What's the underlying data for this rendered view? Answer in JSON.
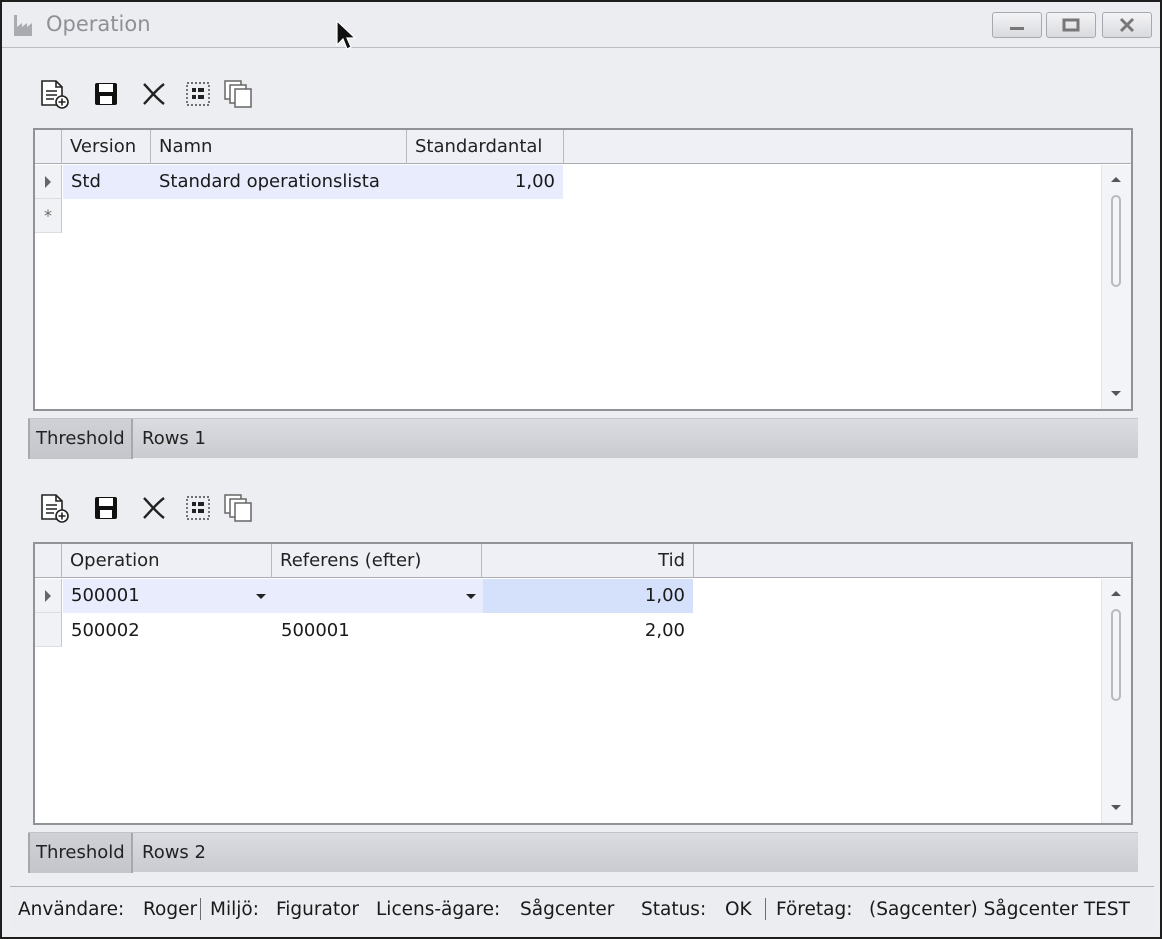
{
  "window": {
    "title": "Operation",
    "icon": "factory-icon",
    "controls": [
      "minimize-icon",
      "maximize-icon",
      "close-icon"
    ]
  },
  "toolbar_icons": [
    "new-document-icon",
    "save-icon",
    "delete-icon",
    "select-icon",
    "copy-icon"
  ],
  "grid1": {
    "columns": [
      "Version",
      "Namn",
      "Standardantal"
    ],
    "rows": [
      {
        "version": "Std",
        "namn": "Standard operationslista",
        "standardantal": "1,00"
      }
    ],
    "new_row_marker": "*",
    "footer_label": "Threshold",
    "footer_rows": "Rows 1"
  },
  "grid2": {
    "columns": [
      "Operation",
      "Referens (efter)",
      "Tid"
    ],
    "rows": [
      {
        "operation": "500001",
        "referens": "",
        "tid": "1,00"
      },
      {
        "operation": "500002",
        "referens": "500001",
        "tid": "2,00"
      }
    ],
    "footer_label": "Threshold",
    "footer_rows": "Rows 2"
  },
  "statusbar": {
    "user_label": "Användare:",
    "user_value": "Roger",
    "env_label": "Miljö:",
    "env_value": "Figurator",
    "license_label": "Licens-ägare:",
    "license_value": "Sågcenter",
    "status_label": "Status:",
    "status_value": "OK",
    "company_label": "Företag:",
    "company_value": "(Sagcenter) Sågcenter TEST"
  },
  "colors": {
    "selected_cell": "#e8ecfc",
    "focused_cell": "#d5e0fb",
    "header_bg": "#eef0f5",
    "window_bg": "#edeef2"
  }
}
